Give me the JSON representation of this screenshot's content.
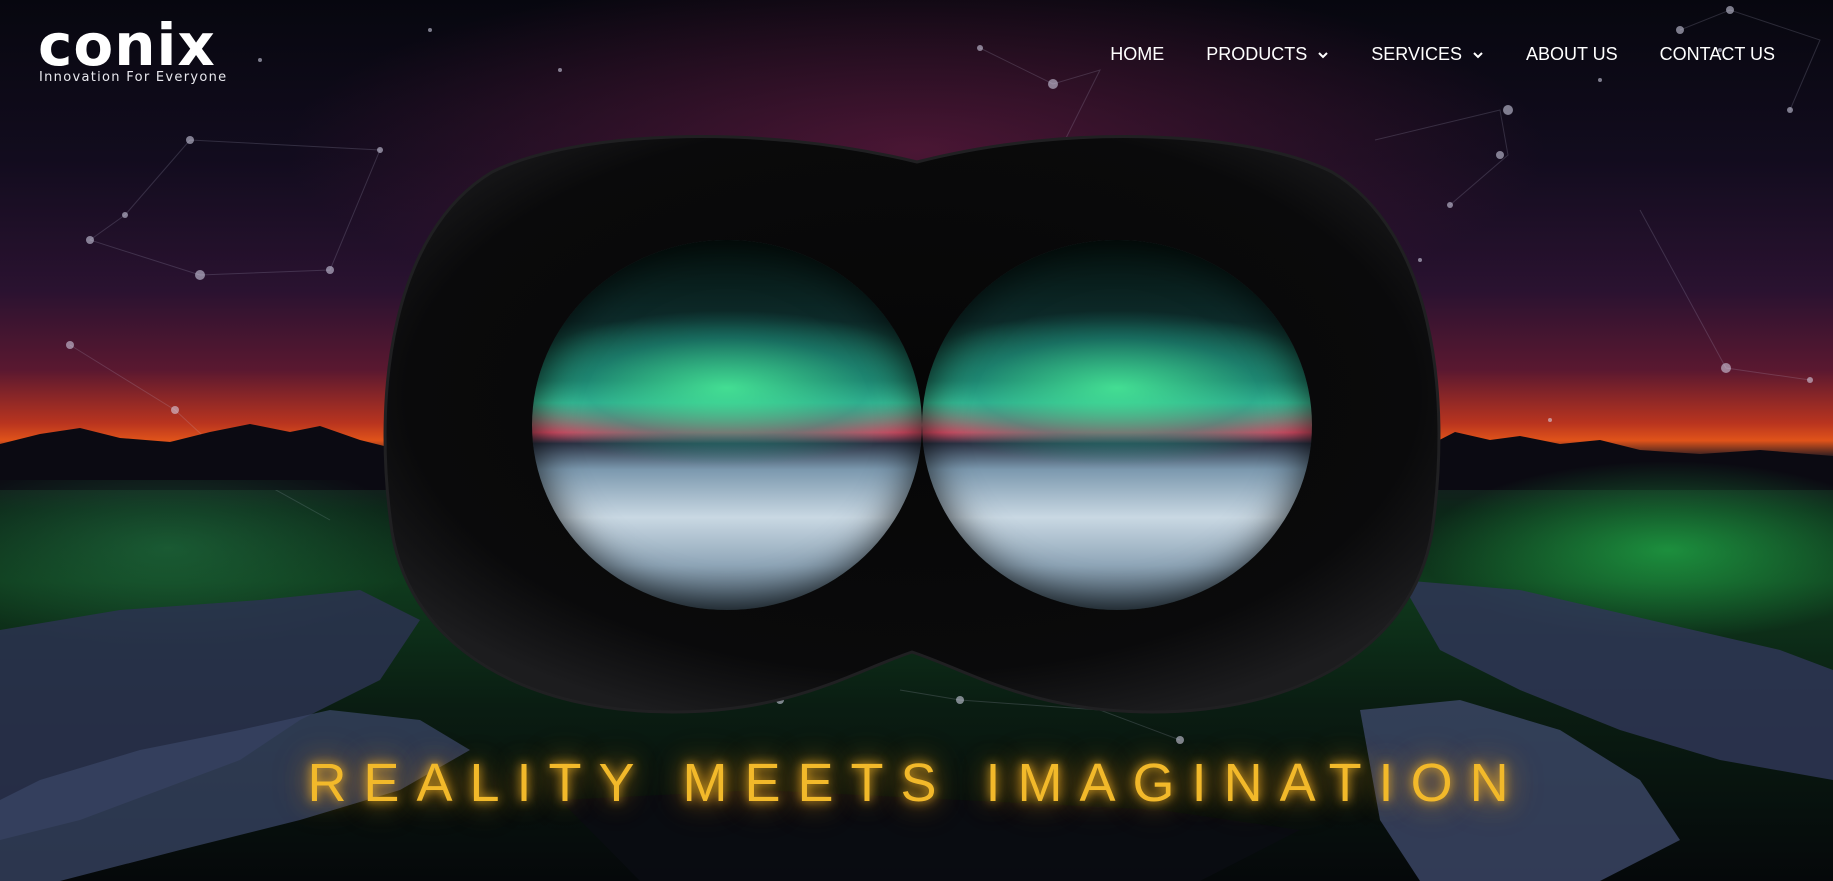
{
  "brand": {
    "logo_text": "conix",
    "tagline": "Innovation For Everyone"
  },
  "nav": {
    "items": [
      {
        "label": "HOME",
        "has_dropdown": false
      },
      {
        "label": "PRODUCTS",
        "has_dropdown": true
      },
      {
        "label": "SERVICES",
        "has_dropdown": true
      },
      {
        "label": "ABOUT US",
        "has_dropdown": false
      },
      {
        "label": "CONTACT US",
        "has_dropdown": false
      }
    ]
  },
  "hero": {
    "headline": "REALITY MEETS IMAGINATION"
  },
  "icons": {
    "dropdown": "chevron-down-icon"
  },
  "colors": {
    "headline": "#f2b92a",
    "nav_text": "#ffffff",
    "horizon": "#e0531a",
    "aurora": "#3ec79a"
  }
}
